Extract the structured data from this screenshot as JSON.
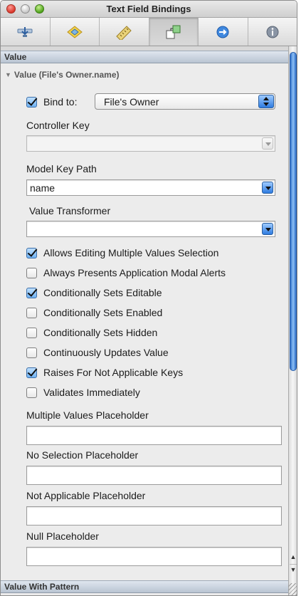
{
  "window": {
    "title": "Text Field Bindings"
  },
  "toolbar": {
    "tabs": [
      {
        "icon": "attributes-icon",
        "active": false
      },
      {
        "icon": "effects-icon",
        "active": false
      },
      {
        "icon": "size-ruler-icon",
        "active": false
      },
      {
        "icon": "bindings-icon",
        "active": true
      },
      {
        "icon": "connections-arrow-icon",
        "active": false
      },
      {
        "icon": "identity-info-icon",
        "active": false
      }
    ]
  },
  "sections": {
    "value_header": "Value",
    "disclosure": "Value (File's Owner.name)",
    "bottom_header": "Value With Pattern"
  },
  "bind": {
    "checked": true,
    "label": "Bind to:",
    "target": "File's Owner"
  },
  "controller_key": {
    "label": "Controller Key",
    "value": ""
  },
  "model_key_path": {
    "label": "Model Key Path",
    "value": "name"
  },
  "value_transformer": {
    "label": "Value Transformer",
    "value": ""
  },
  "options": [
    {
      "label": "Allows Editing Multiple Values Selection",
      "checked": true
    },
    {
      "label": "Always Presents Application Modal Alerts",
      "checked": false
    },
    {
      "label": "Conditionally Sets Editable",
      "checked": true
    },
    {
      "label": "Conditionally Sets Enabled",
      "checked": false
    },
    {
      "label": "Conditionally Sets Hidden",
      "checked": false
    },
    {
      "label": "Continuously Updates Value",
      "checked": false
    },
    {
      "label": "Raises For Not Applicable Keys",
      "checked": true
    },
    {
      "label": "Validates Immediately",
      "checked": false
    }
  ],
  "placeholders": [
    {
      "label": "Multiple Values Placeholder",
      "value": ""
    },
    {
      "label": "No Selection Placeholder",
      "value": ""
    },
    {
      "label": "Not Applicable Placeholder",
      "value": ""
    },
    {
      "label": "Null Placeholder",
      "value": ""
    }
  ],
  "colors": {
    "accent": "#2e7be0",
    "section_bar": "#c9d2de"
  }
}
